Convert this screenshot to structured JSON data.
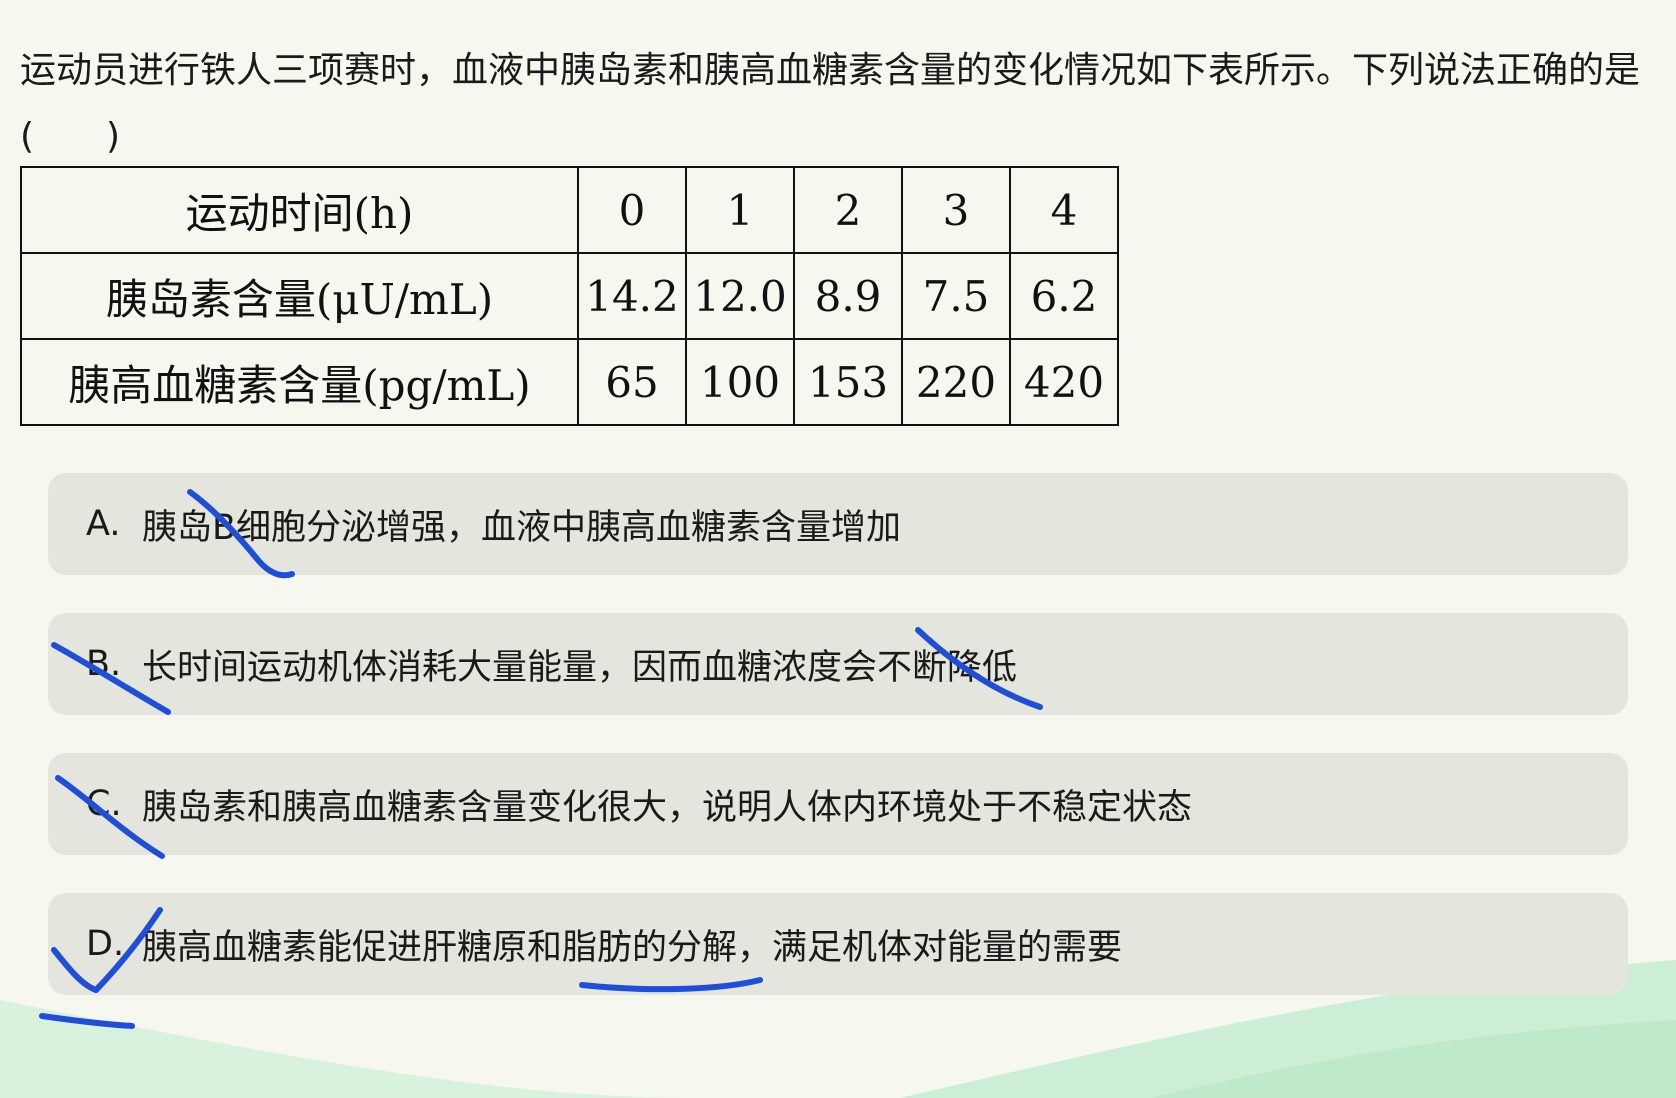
{
  "question": {
    "text": "运动员进行铁人三项赛时，血液中胰岛素和胰高血糖素含量的变化情况如下表所示。下列说法正确的是(　　)"
  },
  "table": {
    "header": {
      "label": "运动时间(h)",
      "cells": [
        "0",
        "1",
        "2",
        "3",
        "4"
      ]
    },
    "rows": [
      {
        "label": "胰岛素含量(μU/mL)",
        "cells": [
          "14.2",
          "12.0",
          "8.9",
          "7.5",
          "6.2"
        ]
      },
      {
        "label": "胰高血糖素含量(pg/mL)",
        "cells": [
          "65",
          "100",
          "153",
          "220",
          "420"
        ]
      }
    ]
  },
  "options": [
    {
      "letter": "A.",
      "text": "胰岛B细胞分泌增强，血液中胰高血糖素含量增加"
    },
    {
      "letter": "B.",
      "text": "长时间运动机体消耗大量能量，因而血糖浓度会不断降低"
    },
    {
      "letter": "C.",
      "text": "胰岛素和胰高血糖素含量变化很大，说明人体内环境处于不稳定状态"
    },
    {
      "letter": "D.",
      "text": "胰高血糖素能促进肝糖原和脂肪的分解，满足机体对能量的需要"
    }
  ],
  "colors": {
    "background": "#f6f7ee",
    "option_background": "#e4e5dd",
    "annotation_ink": "#1f4fd8",
    "wave": "#cdeed6"
  }
}
